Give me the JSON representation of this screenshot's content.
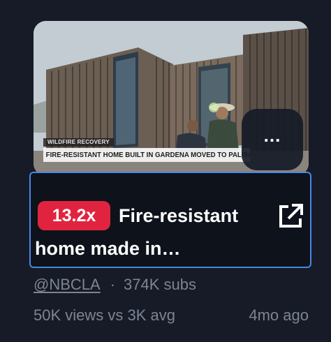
{
  "video": {
    "chyron_kicker": "WILDFIRE RECOVERY",
    "chyron_headline": "FIRE-RESISTANT HOME BUILT IN GARDENA MOVED TO PALISADES",
    "more_label": "...",
    "badge": "13.2x",
    "title_line1": "Fire-resistant",
    "title_line2": "home made in…",
    "channel": "@NBCLA",
    "separator": "·",
    "subscribers": "374K subs",
    "views": "50K views vs 3K avg",
    "age": "4mo ago"
  },
  "icons": {
    "open_external": "external-link-icon",
    "more": "more-options-icon"
  },
  "colors": {
    "background": "#161b27",
    "badge": "#e0243f",
    "focus_border": "#4a86e8",
    "meta_text": "#7d8494"
  }
}
